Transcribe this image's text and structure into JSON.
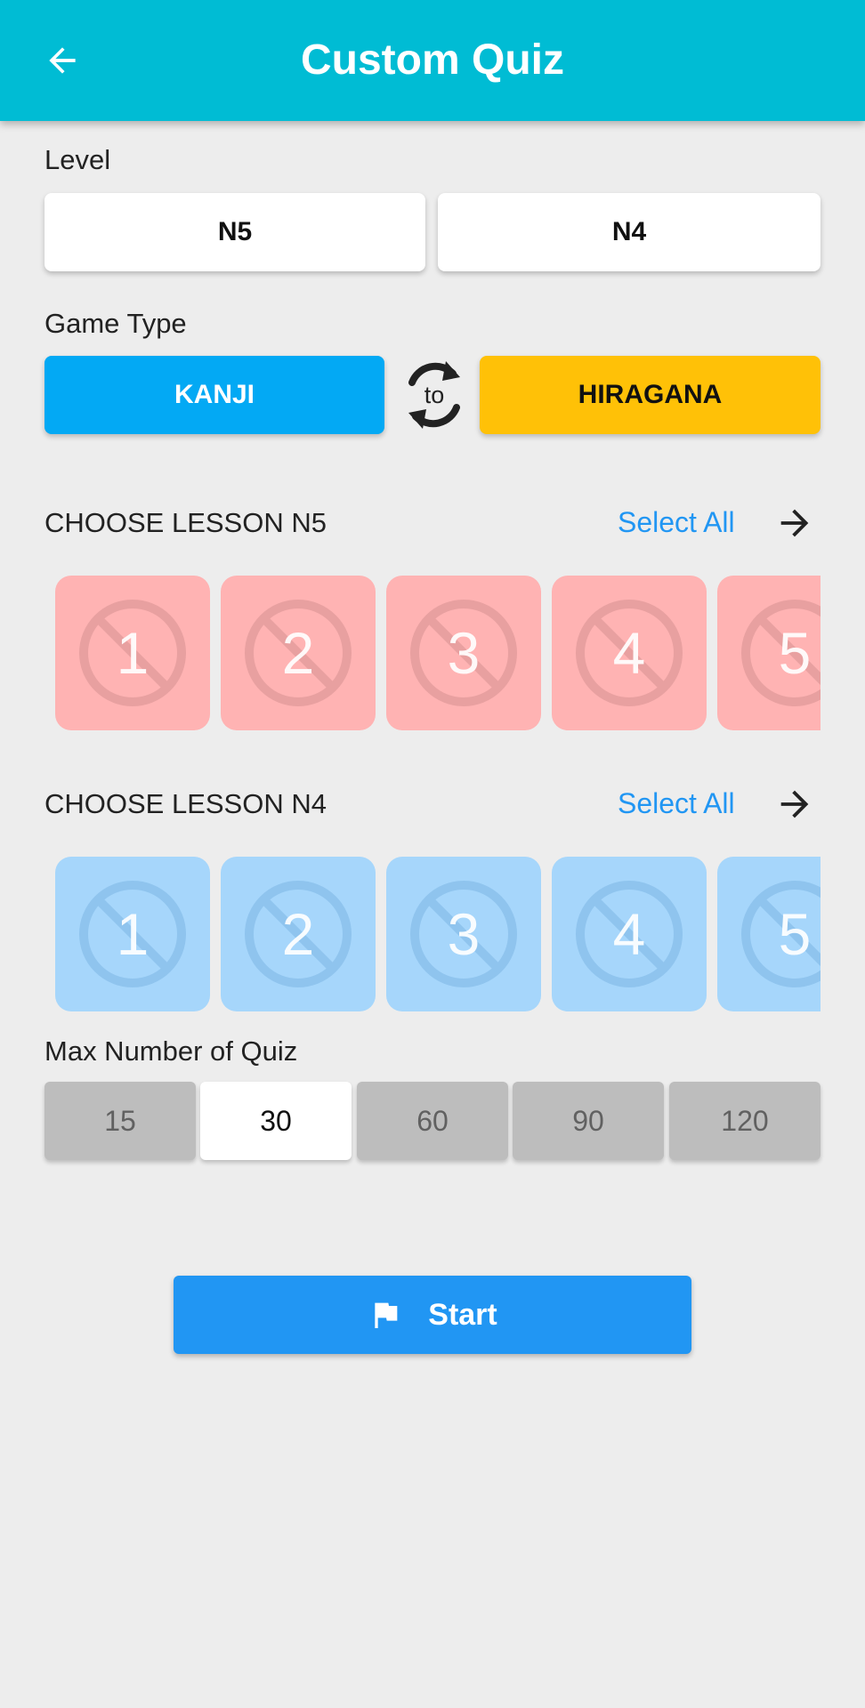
{
  "header": {
    "title": "Custom Quiz",
    "back_icon": "arrow-left-icon",
    "color": "#00bcd4"
  },
  "level": {
    "label": "Level",
    "options": [
      "N5",
      "N4"
    ]
  },
  "game_type": {
    "label": "Game Type",
    "from": "KANJI",
    "swap_text": "to",
    "to": "HIRAGANA",
    "from_color": "#03a9f4",
    "to_color": "#ffc107"
  },
  "lessons_n5": {
    "title": "CHOOSE LESSON N5",
    "select_all": "Select All",
    "items": [
      "1",
      "2",
      "3",
      "4",
      "5"
    ],
    "color": "#ffb3b3"
  },
  "lessons_n4": {
    "title": "CHOOSE LESSON N4",
    "select_all": "Select All",
    "items": [
      "1",
      "2",
      "3",
      "4",
      "5"
    ],
    "color": "#a6d6fb"
  },
  "max_quiz": {
    "label": "Max Number of Quiz",
    "options": [
      "15",
      "30",
      "60",
      "90",
      "120"
    ],
    "selected": "30"
  },
  "start": {
    "label": "Start",
    "icon": "flag-icon",
    "color": "#2196f3"
  }
}
